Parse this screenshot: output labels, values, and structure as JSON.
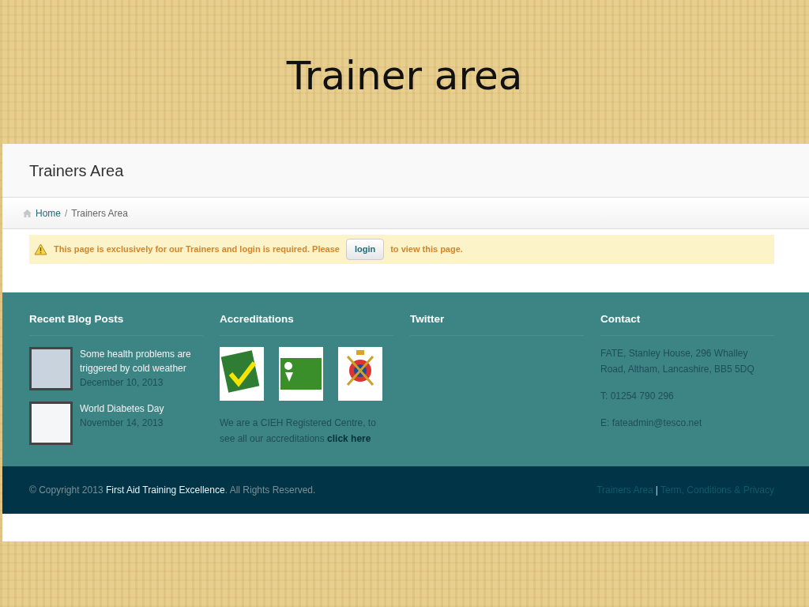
{
  "slide_title": "Trainer area",
  "page": {
    "title": "Trainers Area",
    "breadcrumb": [
      {
        "label": "Home",
        "kind": "link"
      },
      {
        "label": "Trainers Area",
        "kind": "current"
      }
    ],
    "breadcrumb_separator": "/",
    "alert": {
      "text_before": "This page is exclusively for our Trainers and login is required. Please",
      "button": "login",
      "text_after": "to view this page."
    }
  },
  "footer": {
    "blog": {
      "heading": "Recent Blog Posts",
      "posts": [
        {
          "title": "Some health problems are triggered by cold weather",
          "date": "December 10, 2013"
        },
        {
          "title": "World Diabetes Day",
          "date": "November 14, 2013"
        }
      ]
    },
    "accreditations": {
      "heading": "Accreditations",
      "logos": [
        {
          "kind": "insurance"
        },
        {
          "kind": "member"
        },
        {
          "kind": "crest"
        }
      ],
      "text": "We are a CIEH Registered Centre, to see all our accreditations",
      "link": "click here"
    },
    "twitter": {
      "heading": "Twitter"
    },
    "contact": {
      "heading": "Contact",
      "lines": [
        "FATE, Stanley House, 296 Whalley Road, Altham, Lancashire, BB5 5DQ",
        "T: 01254 790 296",
        "E: fateadmin@tesco.net"
      ]
    }
  },
  "bottom_bar": {
    "copyright": "© Copyright 2013 **First Aid Training Excellence**. All Rights Reserved.",
    "links": [
      "Trainers Area",
      "Term, Conditions & Privacy"
    ],
    "separator": "|"
  }
}
